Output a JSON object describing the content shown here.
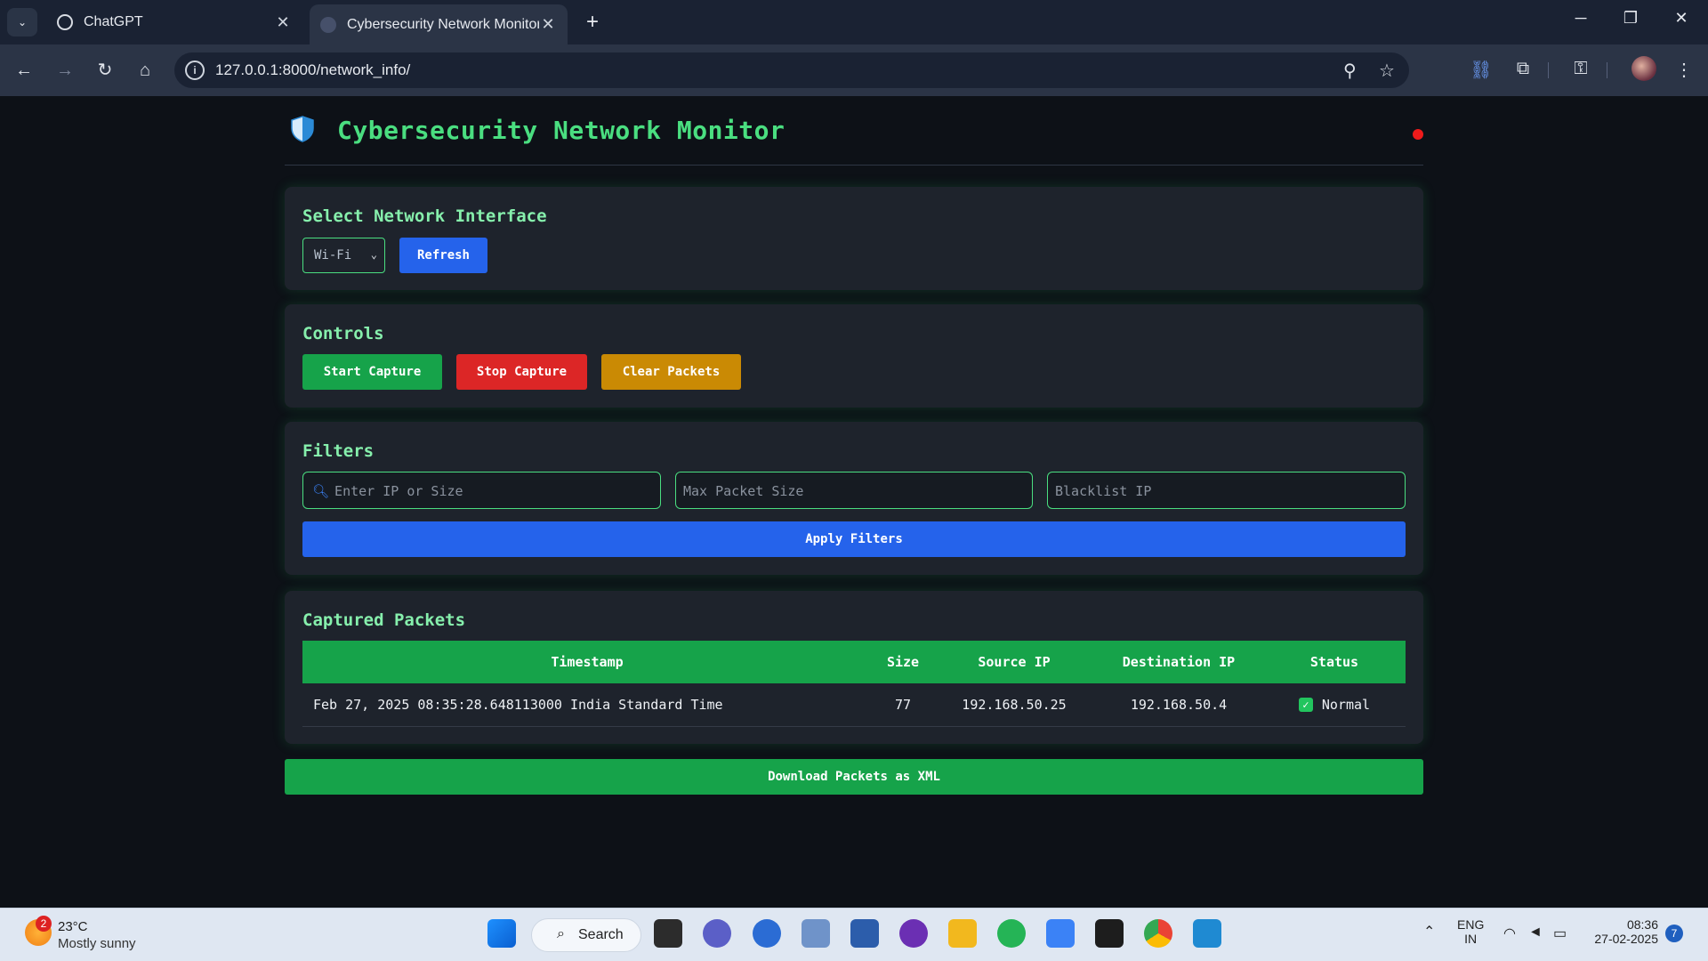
{
  "browser": {
    "tabs": [
      {
        "label": "ChatGPT",
        "active": false
      },
      {
        "label": "Cybersecurity Network Monitor",
        "active": true
      }
    ],
    "url": "127.0.0.1:8000/network_info/"
  },
  "header": {
    "title": "Cybersecurity Network Monitor",
    "status_color": "#ef1b1b"
  },
  "interface_section": {
    "title": "Select Network Interface",
    "selected": "Wi-Fi",
    "refresh_label": "Refresh"
  },
  "controls": {
    "title": "Controls",
    "start_label": "Start Capture",
    "stop_label": "Stop Capture",
    "clear_label": "Clear Packets"
  },
  "filters": {
    "title": "Filters",
    "ip_placeholder": "Enter IP or Size",
    "size_placeholder": "Max Packet Size",
    "blacklist_placeholder": "Blacklist IP",
    "apply_label": "Apply Filters"
  },
  "packets": {
    "title": "Captured Packets",
    "columns": [
      "Timestamp",
      "Size",
      "Source IP",
      "Destination IP",
      "Status"
    ],
    "rows": [
      {
        "timestamp": "Feb 27, 2025 08:35:28.648113000 India Standard Time",
        "size": "77",
        "source_ip": "192.168.50.25",
        "destination_ip": "192.168.50.4",
        "status": "Normal"
      }
    ]
  },
  "download_label": "Download Packets as XML",
  "taskbar": {
    "weather_temp": "23°C",
    "weather_cond": "Mostly sunny",
    "weather_badge": "2",
    "search_label": "Search",
    "lang_top": "ENG",
    "lang_bottom": "IN",
    "time": "08:36",
    "date": "27-02-2025",
    "notification_count": "7"
  },
  "colors": {
    "accent_green": "#4ade80",
    "button_blue": "#2563eb",
    "button_green": "#16a34a",
    "button_red": "#dc2626",
    "button_amber": "#ca8a04"
  }
}
